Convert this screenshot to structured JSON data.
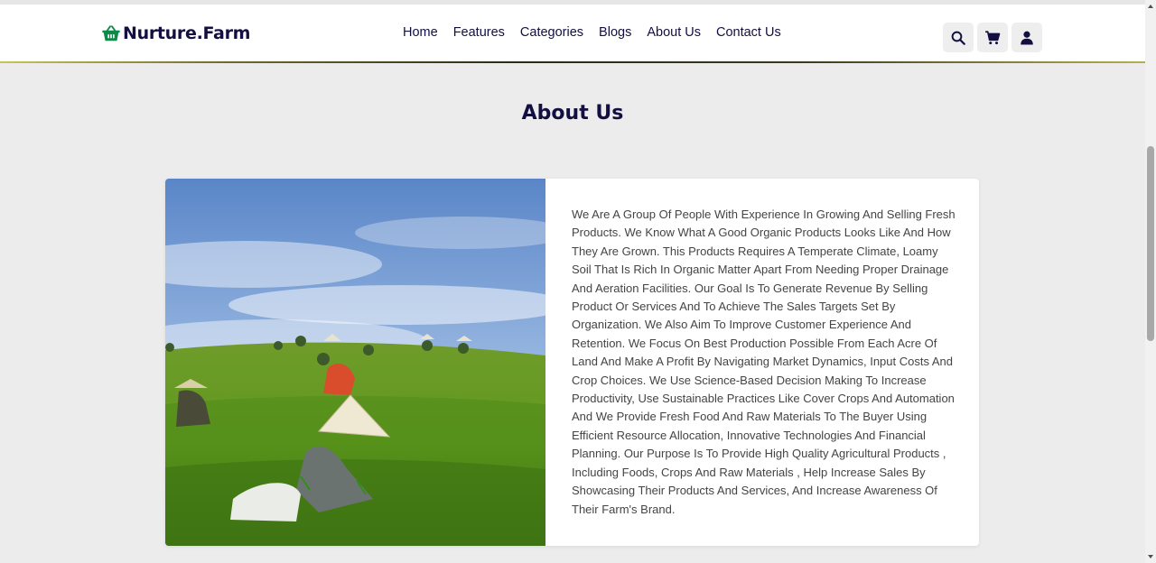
{
  "brand": {
    "name": "Nurture.Farm",
    "accent": "#10884a",
    "text_color": "#130f40"
  },
  "nav": {
    "items": [
      {
        "label": "Home"
      },
      {
        "label": "Features"
      },
      {
        "label": "Categories"
      },
      {
        "label": "Blogs"
      },
      {
        "label": "About Us"
      },
      {
        "label": "Contact Us"
      }
    ]
  },
  "header_icons": [
    "search-icon",
    "cart-icon",
    "user-icon"
  ],
  "about": {
    "title": "About Us",
    "body": "We Are A Group Of People With Experience In Growing And Selling Fresh Products. We Know What A Good Organic Products Looks Like And How They Are Grown. This Products Requires A Temperate Climate, Loamy Soil That Is Rich In Organic Matter Apart From Needing Proper Drainage And Aeration Facilities. Our Goal Is To Generate Revenue By Selling Product Or Services And To Achieve The Sales Targets Set By Organization. We Also Aim To Improve Customer Experience And Retention. We Focus On Best Production Possible From Each Acre Of Land And Make A Profit By Navigating Market Dynamics, Input Costs And Crop Choices. We Use Science-Based Decision Making To Increase Productivity, Use Sustainable Practices Like Cover Crops And Automation And We Provide Fresh Food And Raw Materials To The Buyer Using Efficient Resource Allocation, Innovative Technologies And Financial Planning. Our Purpose Is To Provide High Quality Agricultural Products , Including Foods, Crops And Raw Materials , Help Increase Sales By Showcasing Their Products And Services, And Increase Awareness Of Their Farm's Brand."
  }
}
